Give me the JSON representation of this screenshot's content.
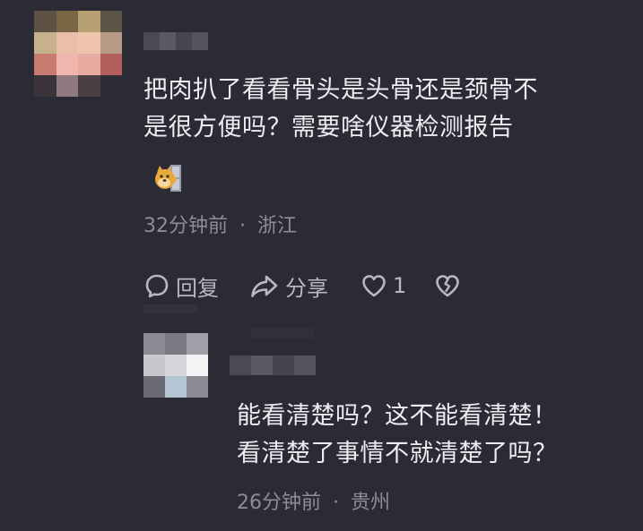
{
  "comment": {
    "text_line1": "把肉扒了看看骨头是头骨还是颈骨不",
    "text_line2": "是很方便吗？需要啥仪器检测报告",
    "emoji_icon": "doge-peeking-icon",
    "time": "32分钟前",
    "separator": "·",
    "location": "浙江",
    "actions": {
      "reply_label": "回复",
      "share_label": "分享",
      "like_count": "1"
    }
  },
  "reply": {
    "text_line1": "能看清楚吗？这不能看清楚！",
    "text_line2": "看清楚了事情不就清楚了吗？",
    "time": "26分钟前",
    "separator": "·",
    "location": "贵州"
  },
  "colors": {
    "background": "#2b2b36",
    "text": "#ececf1",
    "meta": "#8d8d98",
    "icon": "#b8b8c2"
  }
}
